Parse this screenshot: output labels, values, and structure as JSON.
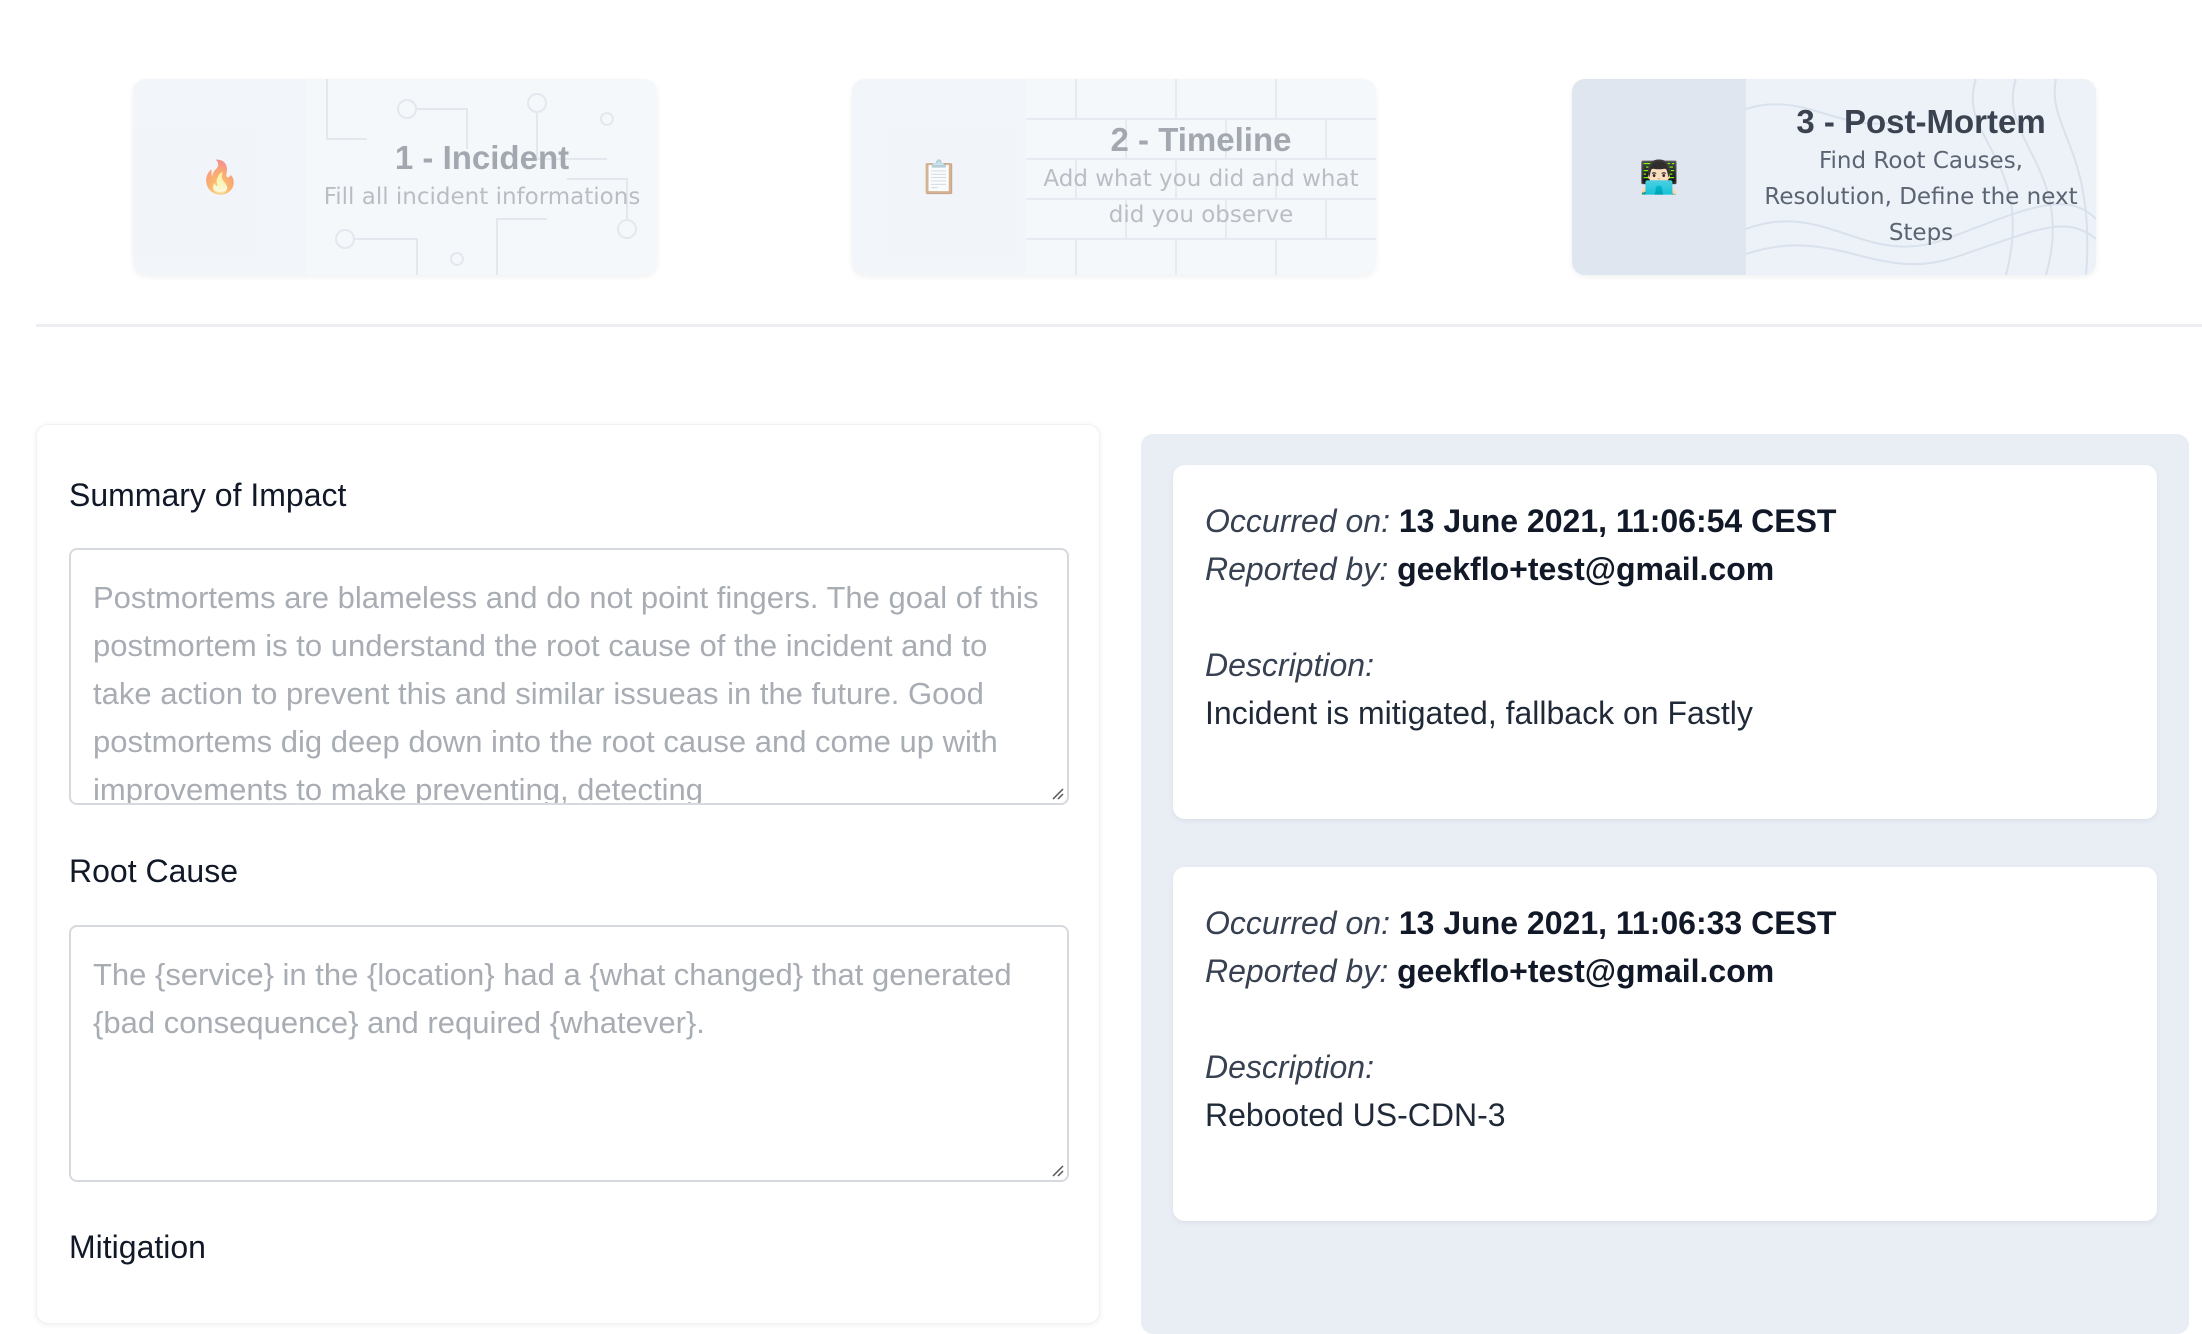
{
  "steps": [
    {
      "icon": "🔥",
      "icon_name": "fire-icon",
      "title": "1 - Incident",
      "subtitle": "Fill all incident informations",
      "state": "done"
    },
    {
      "icon": "📋",
      "icon_name": "clipboard-icon",
      "title": "2 - Timeline",
      "subtitle": "Add what you did and what did you observe",
      "state": "done"
    },
    {
      "icon": "👨🏻‍💻",
      "icon_name": "technologist-icon",
      "title": "3 - Post-Mortem",
      "subtitle": "Find Root Causes, Resolution, Define the next Steps",
      "state": "active"
    }
  ],
  "form": {
    "summary": {
      "label": "Summary of Impact",
      "value": "",
      "placeholder": "Postmortems are blameless and do not point fingers. The goal of this postmortem is to understand the root cause of the incident and to take action to prevent this and similar issueas in the future. Good postmortems dig deep down into the root cause and come up with improvements to make preventing, detecting"
    },
    "root_cause": {
      "label": "Root Cause",
      "value": "",
      "placeholder": "The {service} in the {location} had a {what changed} that generated {bad consequence} and required {whatever}."
    },
    "mitigation": {
      "label": "Mitigation"
    }
  },
  "timeline": {
    "events": [
      {
        "occurred_label": "Occurred on:",
        "occurred_value": "13 June 2021, 11:06:54 CEST",
        "reported_label": "Reported by:",
        "reported_value": "geekflo+test@gmail.com",
        "description_label": "Description:",
        "description": "Incident is mitigated, fallback on Fastly"
      },
      {
        "occurred_label": "Occurred on:",
        "occurred_value": "13 June 2021, 11:06:33 CEST",
        "reported_label": "Reported by:",
        "reported_value": "geekflo+test@gmail.com",
        "description_label": "Description:",
        "description": "Rebooted US-CDN-3"
      }
    ]
  },
  "colors": {
    "active_step_bg": "#edf2f8",
    "timeline_bg": "#e9eef5",
    "placeholder": "#a8adb4"
  }
}
